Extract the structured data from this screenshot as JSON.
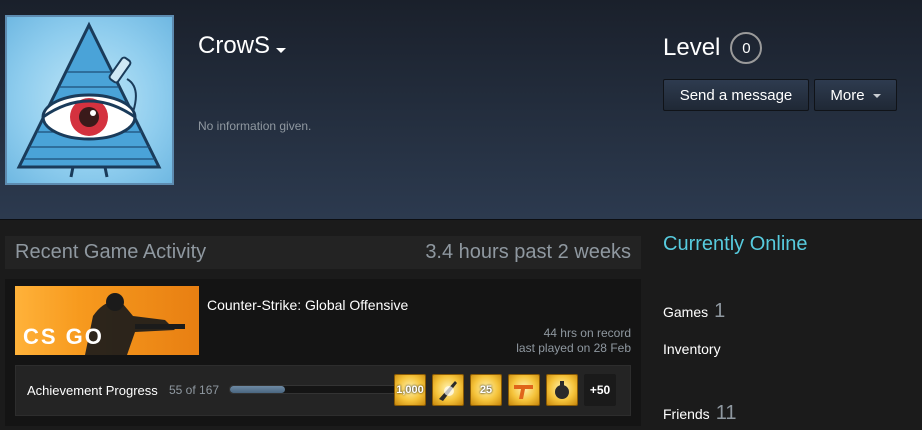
{
  "profile": {
    "persona_name": "CrowS",
    "summary": "No information given.",
    "level_label": "Level",
    "level_value": "0"
  },
  "actions": {
    "send_message": "Send a message",
    "more": "More"
  },
  "activity": {
    "title": "Recent Game Activity",
    "hours_summary": "3.4 hours past 2 weeks",
    "game": {
      "name": "Counter-Strike: Global Offensive",
      "capsule_logo": "CS GO",
      "hours_on_record": "44 hrs on record",
      "last_played": "last played on 28 Feb",
      "achievements": {
        "label": "Achievement Progress",
        "count": "55 of 167",
        "progress_fraction": 0.33,
        "badges": [
          {
            "icon": "rifle-achievement-icon",
            "text": "1,000"
          },
          {
            "icon": "knife-achievement-icon",
            "text": ""
          },
          {
            "icon": "pistol-achievement-icon",
            "text": "25"
          },
          {
            "icon": "shotgun-achievement-icon",
            "text": ""
          },
          {
            "icon": "grenade-achievement-icon",
            "text": ""
          }
        ],
        "more": "+50"
      }
    }
  },
  "sidebar": {
    "status": "Currently Online",
    "games_label": "Games",
    "games_count": "1",
    "inventory_label": "Inventory",
    "friends_label": "Friends",
    "friends_count": "11"
  },
  "colors": {
    "online": "#57cbde",
    "accent_badge": "#f5c33a",
    "background": "#1b1b1b"
  }
}
